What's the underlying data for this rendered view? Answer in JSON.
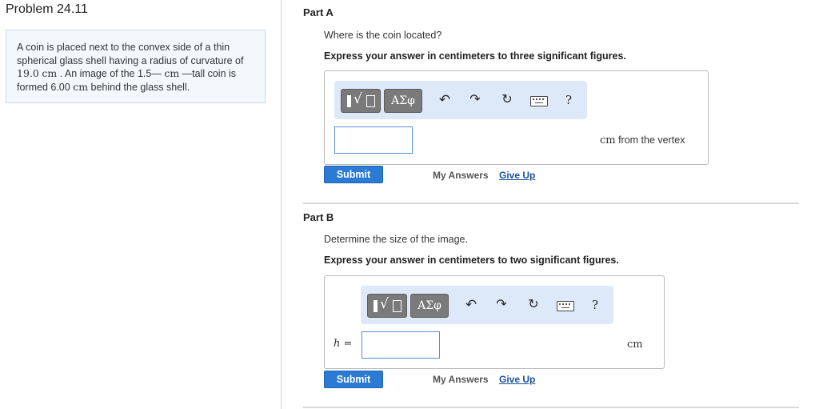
{
  "problem": {
    "title": "Problem 24.11",
    "text": {
      "p1": "A coin is placed next to the convex side of a thin spherical glass shell having a radius of curvature of ",
      "radius_value": "19.0",
      "unit_cm": "cm",
      "p2": " . An image of the 1.5",
      "p3": " —tall coin is formed 6.00 ",
      "p4": " behind the glass shell."
    }
  },
  "parts": [
    {
      "title": "Part A",
      "question": "Where is the coin located?",
      "instruction": "Express your answer in centimeters to three significant figures.",
      "units_unit": "cm",
      "units_text": " from the vertex",
      "submit": "Submit",
      "my_answers": "My Answers",
      "give_up": "Give Up"
    },
    {
      "title": "Part B",
      "question": "Determine the size of the image.",
      "instruction": "Express your answer in centimeters to two significant figures.",
      "var_name": "h",
      "var_eq": " =",
      "units_unit": "cm",
      "submit": "Submit",
      "my_answers": "My Answers",
      "give_up": "Give Up"
    }
  ],
  "toolbar": {
    "greek_label": "ΑΣφ",
    "help_label": "?",
    "icons": [
      "templates-icon",
      "greek-letters-icon",
      "undo-icon",
      "redo-icon",
      "reset-icon",
      "keyboard-icon",
      "help-icon"
    ]
  }
}
